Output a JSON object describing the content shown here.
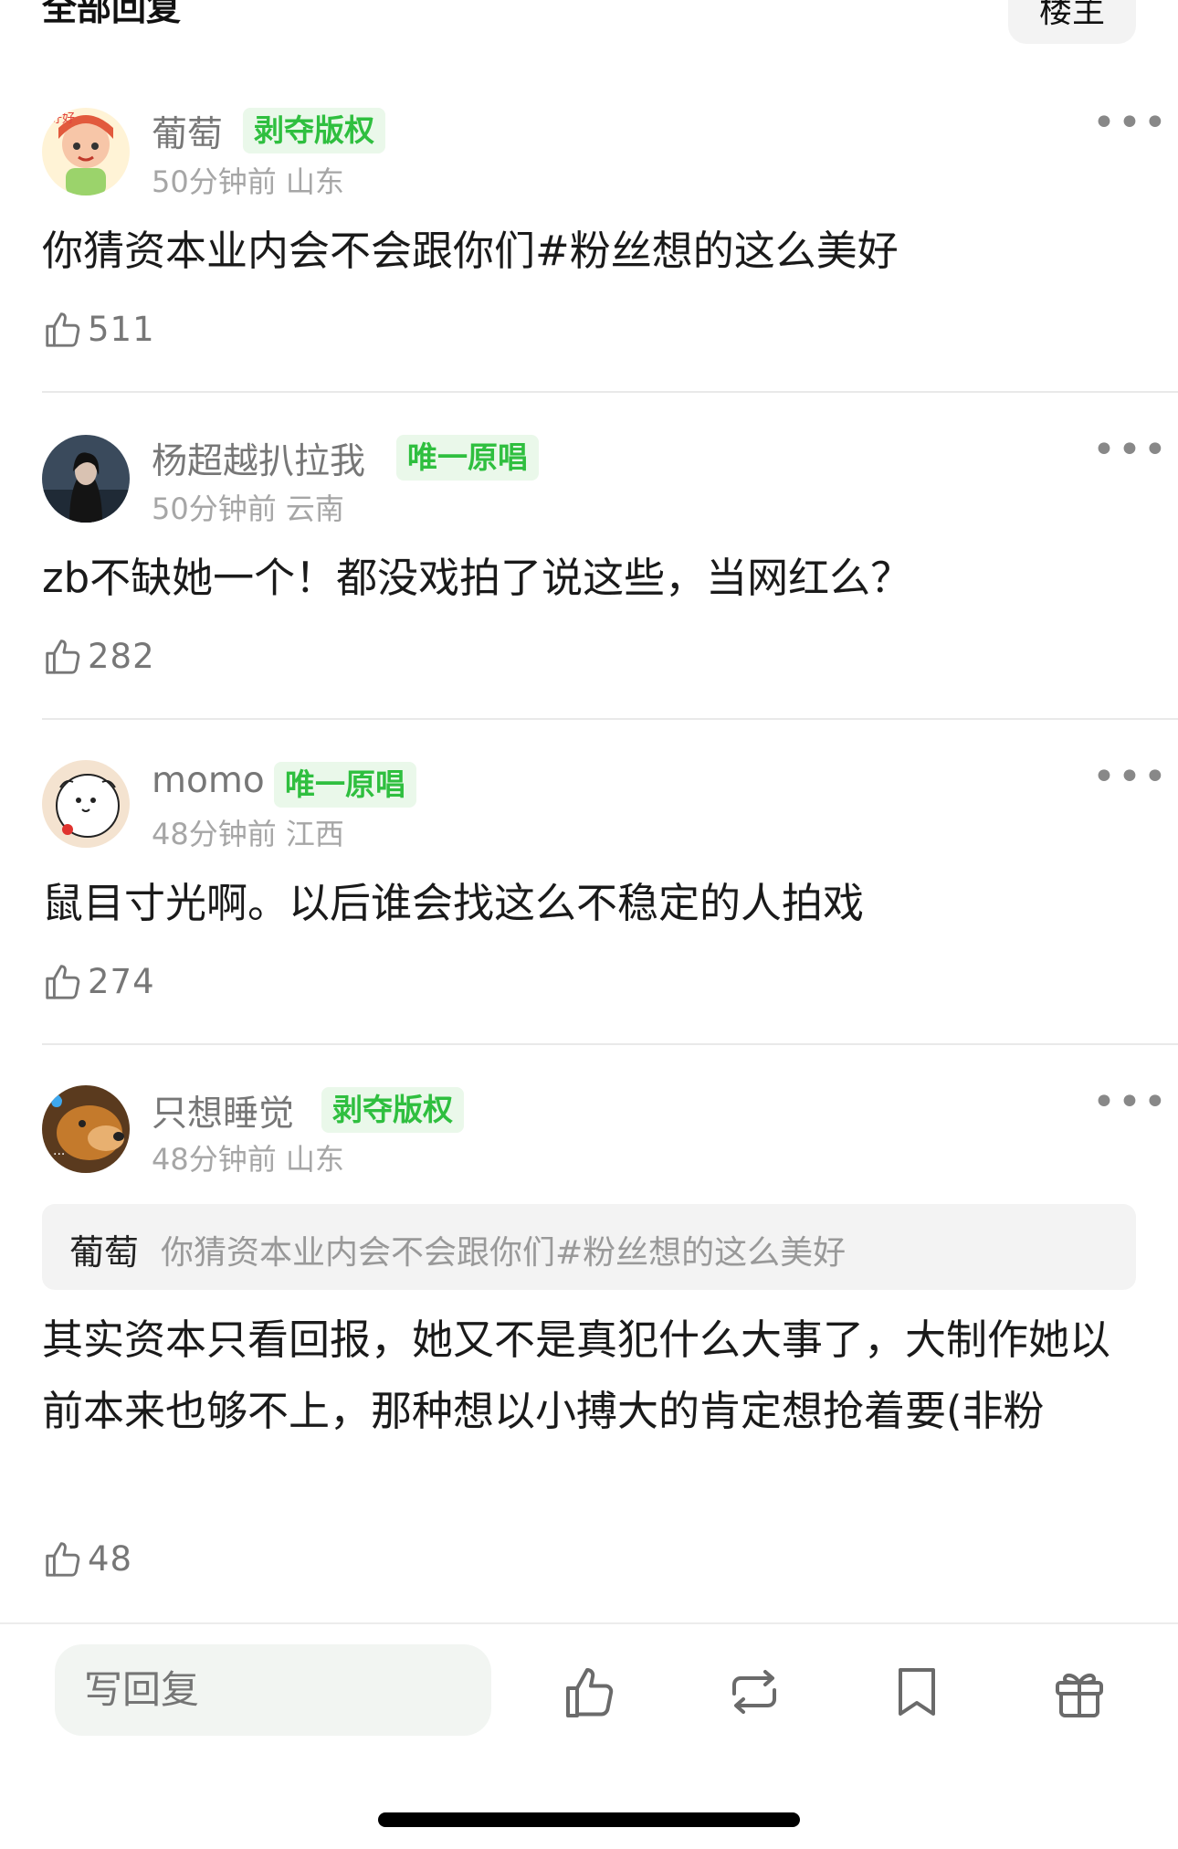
{
  "header": {
    "title": "全部回复",
    "author_filter": "楼主"
  },
  "comments": [
    {
      "name": "葡萄",
      "badge": "剥夺版权",
      "meta": "50分钟前 山东",
      "text": "你猜资本业内会不会跟你们#粉丝想的这么美好",
      "likes": "511"
    },
    {
      "name": "杨超越扒拉我",
      "badge": "唯一原唱",
      "meta": "50分钟前 云南",
      "text": "zb不缺她一个！都没戏拍了说这些，当网红么？",
      "likes": "282"
    },
    {
      "name": "momo",
      "badge": "唯一原唱",
      "meta": "48分钟前 江西",
      "text": "鼠目寸光啊。以后谁会找这么不稳定的人拍戏",
      "likes": "274"
    },
    {
      "name": "只想睡觉",
      "badge": "剥夺版权",
      "meta": "48分钟前 山东",
      "quote": {
        "name": "葡萄",
        "text": "你猜资本业内会不会跟你们#粉丝想的这么美好"
      },
      "text": "其实资本只看回报，她又不是真犯什么大事了，大制作她以前本来也够不上，那种想以小搏大的肯定想抢着要(非粉",
      "likes": "48"
    }
  ],
  "bottom_bar": {
    "reply_placeholder": "写回复",
    "actions": [
      "like-icon",
      "repost-icon",
      "bookmark-icon",
      "gift-icon"
    ]
  },
  "colors": {
    "badge_green": "#2fbf3f",
    "badge_bg": "#eaf8ea",
    "muted": "#a6a6a6"
  }
}
